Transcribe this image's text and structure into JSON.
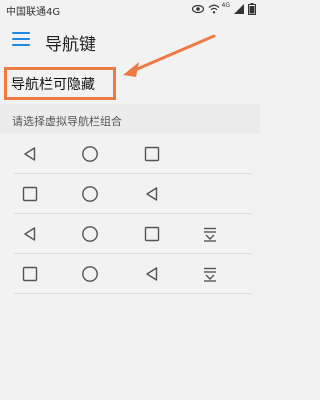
{
  "status_bar": {
    "carrier": "中国联通4G",
    "signal_label": "4G"
  },
  "header": {
    "title": "导航键",
    "menu_icon": "hamburger-menu-icon",
    "accent_color": "#1e88e5"
  },
  "toggle": {
    "label": "导航栏可隐藏"
  },
  "annotation": {
    "color": "#ee7a43"
  },
  "combinations": {
    "title": "请选择虚拟导航栏组合",
    "options": [
      {
        "keys": [
          "back-triangle-icon",
          "home-circle-icon",
          "recent-square-icon"
        ]
      },
      {
        "keys": [
          "recent-square-icon",
          "home-circle-icon",
          "back-triangle-icon"
        ]
      },
      {
        "keys": [
          "back-triangle-icon",
          "home-circle-icon",
          "recent-square-icon",
          "notification-pull-down-icon"
        ]
      },
      {
        "keys": [
          "recent-square-icon",
          "home-circle-icon",
          "back-triangle-icon",
          "notification-pull-down-icon"
        ]
      }
    ]
  }
}
